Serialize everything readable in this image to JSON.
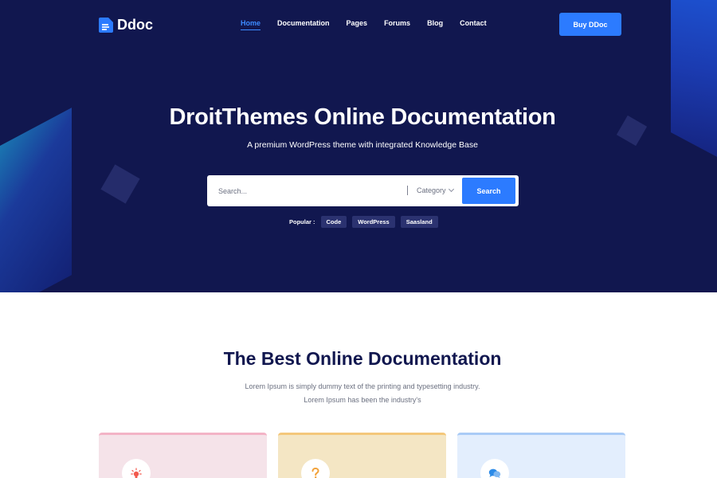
{
  "nav": {
    "logo_text": "Ddoc",
    "items": [
      {
        "label": "Home",
        "active": true
      },
      {
        "label": "Documentation",
        "active": false
      },
      {
        "label": "Pages",
        "active": false
      },
      {
        "label": "Forums",
        "active": false
      },
      {
        "label": "Blog",
        "active": false
      },
      {
        "label": "Contact",
        "active": false
      }
    ],
    "cta_label": "Buy DDoc"
  },
  "hero": {
    "title": "DroitThemes Online Documentation",
    "subtitle": "A premium WordPress theme with integrated Knowledge Base",
    "search": {
      "placeholder": "Search...",
      "category_label": "Category",
      "button_label": "Search"
    },
    "popular": {
      "label": "Popular :",
      "tags": [
        "Code",
        "WordPress",
        "Saasland"
      ]
    }
  },
  "section": {
    "title": "The Best Online Documentation",
    "desc_line1": "Lorem Ipsum is simply dummy text of the printing and typesetting industry.",
    "desc_line2": "Lorem Ipsum has been the industry's"
  },
  "cards": [
    {
      "icon": "lightbulb-icon",
      "icon_glyph": "✺",
      "icon_color": "#f2594d"
    },
    {
      "icon": "question-icon",
      "icon_glyph": "?",
      "icon_color": "#f2a23a"
    },
    {
      "icon": "chat-bubbles-icon",
      "icon_glyph": "",
      "icon_color": "#2c8be8"
    }
  ],
  "colors": {
    "hero_bg": "#11174f",
    "accent": "#2c7bff",
    "tag_bg": "#2b3270"
  }
}
